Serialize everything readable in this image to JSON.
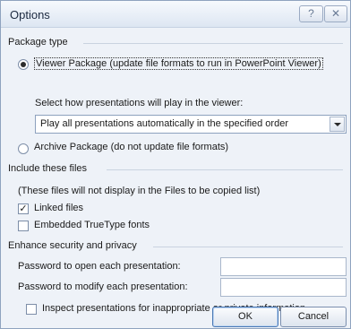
{
  "window": {
    "title": "Options",
    "help_glyph": "?",
    "close_glyph": "✕"
  },
  "package_type": {
    "heading": "Package type",
    "viewer_option": "Viewer Package (update file formats to run in PowerPoint Viewer)",
    "viewer_selected": true,
    "select_prompt": "Select how presentations will play in the viewer:",
    "select_value": "Play all presentations automatically in the specified order",
    "archive_option": "Archive Package (do not update file formats)",
    "archive_selected": false
  },
  "include_files": {
    "heading": "Include these files",
    "note": "(These files will not display in the Files to be copied list)",
    "linked_files": {
      "label": "Linked files",
      "checked": true
    },
    "truetype_fonts": {
      "label": "Embedded TrueType fonts",
      "checked": false
    }
  },
  "security": {
    "heading": "Enhance security and privacy",
    "open_password_label": "Password to open each presentation:",
    "open_password_value": "",
    "modify_password_label": "Password to modify each presentation:",
    "modify_password_value": "",
    "inspect_label": "Inspect presentations for inappropriate or private information",
    "inspect_checked": false
  },
  "buttons": {
    "ok": "OK",
    "cancel": "Cancel"
  },
  "icons": {
    "help": "help-icon",
    "close": "close-icon",
    "dropdown": "chevron-down-icon",
    "check": "checkmark-icon"
  }
}
